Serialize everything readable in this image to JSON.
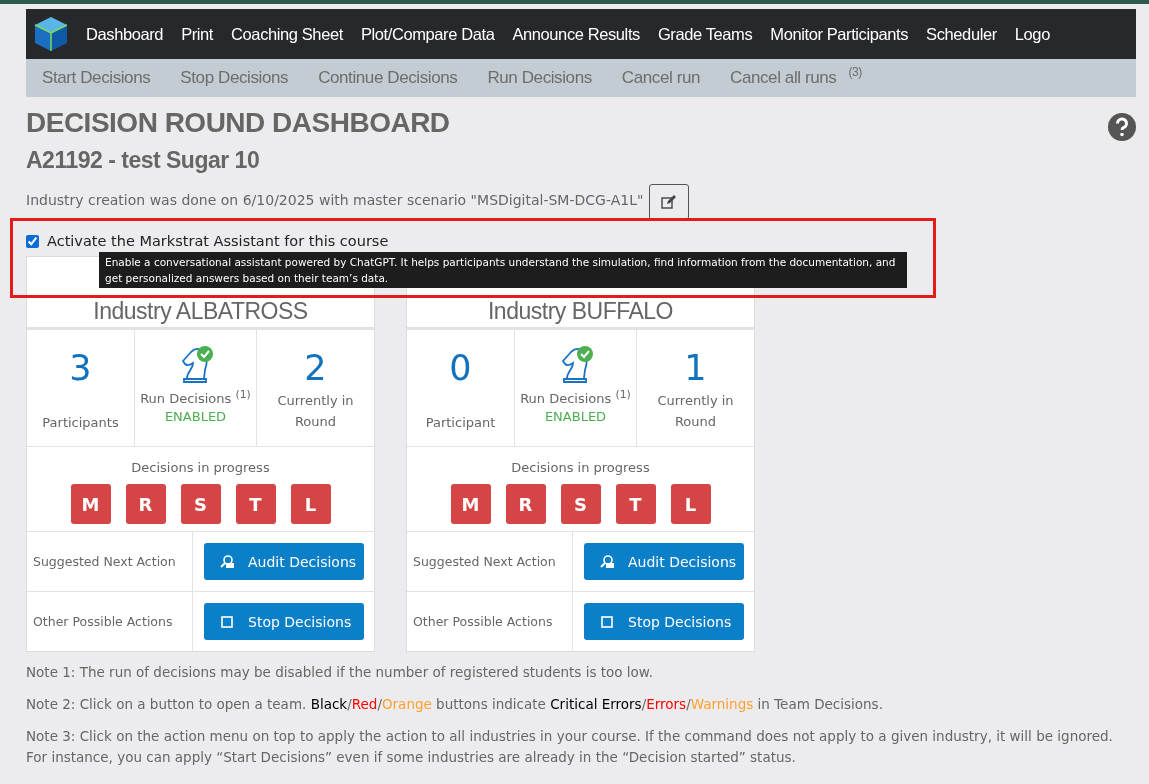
{
  "nav": {
    "items": [
      "Dashboard",
      "Print",
      "Coaching Sheet",
      "Plot/Compare Data",
      "Announce Results",
      "Grade Teams",
      "Monitor Participants",
      "Scheduler",
      "Logo"
    ]
  },
  "subnav": {
    "items": [
      {
        "label": "Start Decisions"
      },
      {
        "label": "Stop Decisions"
      },
      {
        "label": "Continue Decisions"
      },
      {
        "label": "Run Decisions"
      },
      {
        "label": "Cancel run"
      },
      {
        "label": "Cancel all runs",
        "count": "(3)"
      }
    ]
  },
  "page": {
    "title": "DECISION ROUND DASHBOARD",
    "subtitle": "A21192 - test Sugar 10",
    "creation_note": "Industry creation was done on 6/10/2025 with master scenario \"MSDigital-SM-DCG-A1L\""
  },
  "assistant": {
    "label": "Activate the Markstrat Assistant for this course",
    "checked": true,
    "tooltip": "Enable a conversational assistant powered by ChatGPT. It helps participants understand the simulation, find information from the documentation, and get personalized answers based on their team’s data."
  },
  "industries": [
    {
      "title": "Industry ALBATROSS",
      "participants": "3",
      "participants_label": "Participants",
      "run_label": "Run Decisions",
      "run_note": "(1)",
      "run_status": "ENABLED",
      "round": "2",
      "round_label": "Currently in Round",
      "progress_label": "Decisions in progress",
      "teams": [
        "M",
        "R",
        "S",
        "T",
        "L"
      ],
      "suggested_label": "Suggested Next Action",
      "suggested_button": "Audit Decisions",
      "other_label": "Other Possible Actions",
      "other_button": "Stop Decisions"
    },
    {
      "title": "Industry BUFFALO",
      "participants": "0",
      "participants_label": "Participant",
      "run_label": "Run Decisions",
      "run_note": "(1)",
      "run_status": "ENABLED",
      "round": "1",
      "round_label": "Currently in Round",
      "progress_label": "Decisions in progress",
      "teams": [
        "M",
        "R",
        "S",
        "T",
        "L"
      ],
      "suggested_label": "Suggested Next Action",
      "suggested_button": "Audit Decisions",
      "other_label": "Other Possible Actions",
      "other_button": "Stop Decisions"
    }
  ],
  "notes": [
    {
      "segments": [
        {
          "text": "Note 1: The run of decisions may be disabled if the number of registered students is too low."
        }
      ]
    },
    {
      "segments": [
        {
          "text": "Note 2: Click on a button to open a team. "
        },
        {
          "text": "Black",
          "color": "#000000"
        },
        {
          "text": "/"
        },
        {
          "text": "Red",
          "color": "#ff0000"
        },
        {
          "text": "/"
        },
        {
          "text": "Orange",
          "color": "#ff9f2e"
        },
        {
          "text": " buttons indicate "
        },
        {
          "text": "Critical Errors",
          "color": "#000000"
        },
        {
          "text": "/"
        },
        {
          "text": "Errors",
          "color": "#ff0000"
        },
        {
          "text": "/"
        },
        {
          "text": "Warnings",
          "color": "#ff9f2e"
        },
        {
          "text": " in Team Decisions."
        }
      ]
    },
    {
      "segments": [
        {
          "text": "Note 3: Click on the action menu on top to apply the action to all industries in your course. If the command does not apply to a given industry, it will be ignored. For instance, you can apply “Start Decisions” even if some industries are already in the “Decision started” status."
        }
      ]
    }
  ]
}
